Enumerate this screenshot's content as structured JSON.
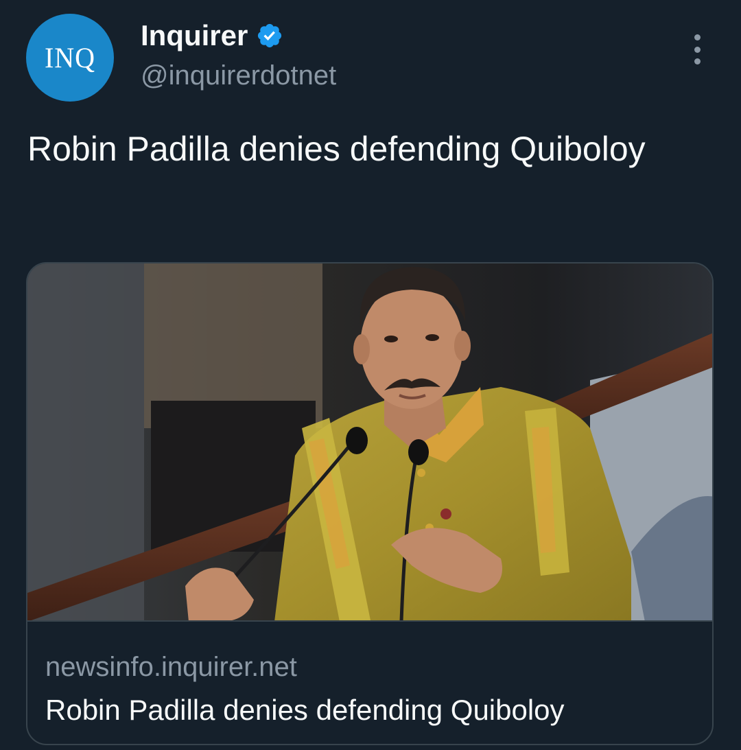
{
  "author": {
    "avatar_text": "INQ",
    "display_name": "Inquirer",
    "handle": "@inquirerdotnet",
    "verified": true
  },
  "tweet": {
    "text": "Robin Padilla denies defending Quiboloy"
  },
  "link_card": {
    "domain": "newsinfo.inquirer.net",
    "title": "Robin Padilla denies defending Quiboloy"
  },
  "icons": {
    "verified": "verified-badge-icon",
    "more": "more-options-icon"
  },
  "colors": {
    "background": "#15202b",
    "primary_text": "#f7f9f9",
    "secondary_text": "#8b98a5",
    "avatar_bg": "#1a87c9",
    "verified_blue": "#1d9bf0",
    "border": "#38444d"
  }
}
